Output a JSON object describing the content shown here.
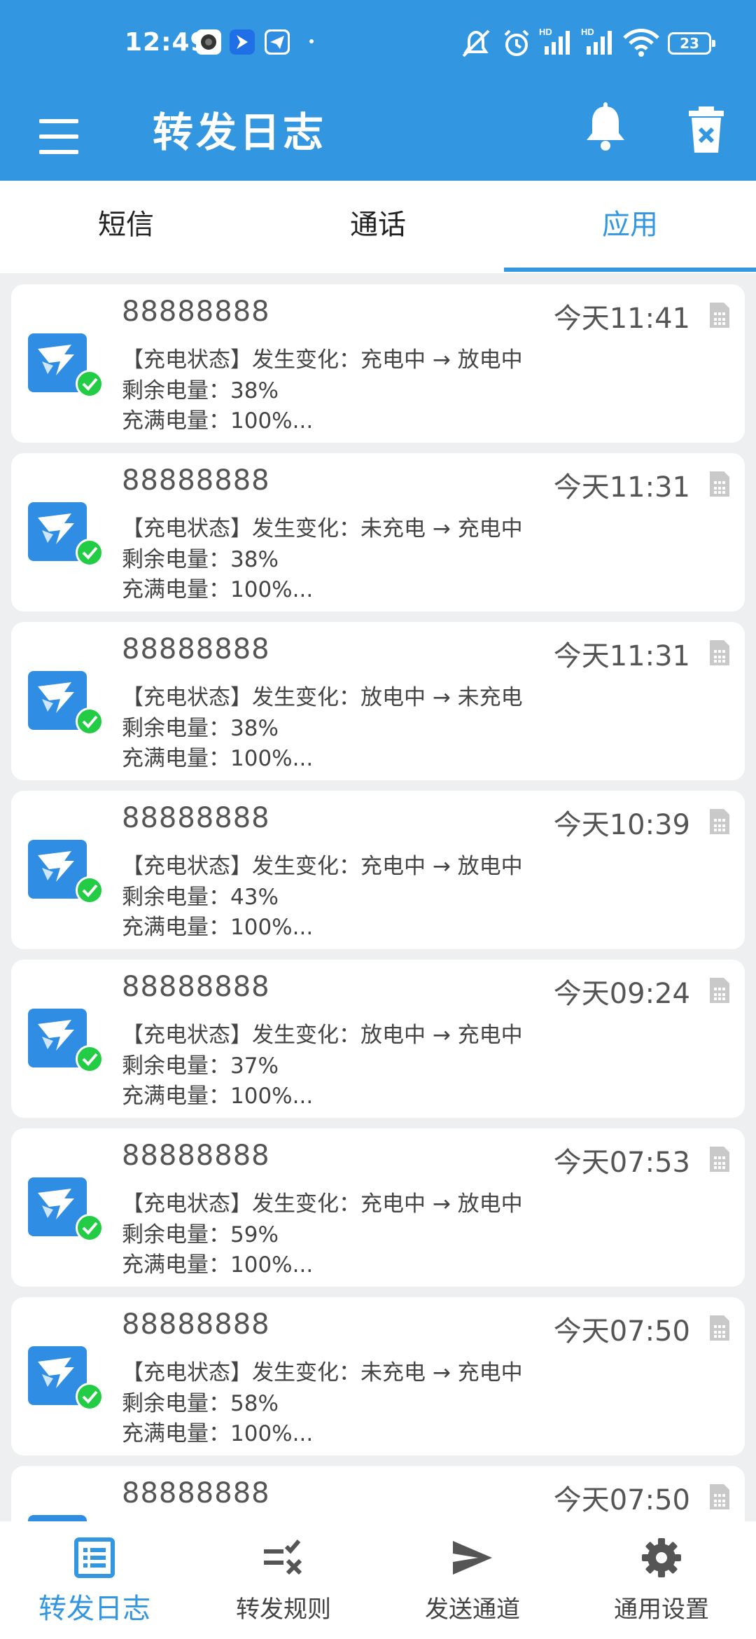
{
  "status_bar": {
    "time": "12:49",
    "battery": "23"
  },
  "toolbar": {
    "title": "转发日志"
  },
  "tabs": [
    {
      "label": "短信"
    },
    {
      "label": "通话"
    },
    {
      "label": "应用"
    }
  ],
  "logs": [
    {
      "sender": "88888888",
      "time": "今天11:41",
      "line1": "【充电状态】发生变化：充电中 → 放电中",
      "line2": "剩余电量：38%",
      "line3": "充满电量：100%..."
    },
    {
      "sender": "88888888",
      "time": "今天11:31",
      "line1": "【充电状态】发生变化：未充电 → 充电中",
      "line2": "剩余电量：38%",
      "line3": "充满电量：100%..."
    },
    {
      "sender": "88888888",
      "time": "今天11:31",
      "line1": "【充电状态】发生变化：放电中 → 未充电",
      "line2": "剩余电量：38%",
      "line3": "充满电量：100%..."
    },
    {
      "sender": "88888888",
      "time": "今天10:39",
      "line1": "【充电状态】发生变化：充电中 → 放电中",
      "line2": "剩余电量：43%",
      "line3": "充满电量：100%..."
    },
    {
      "sender": "88888888",
      "time": "今天09:24",
      "line1": "【充电状态】发生变化：放电中 → 充电中",
      "line2": "剩余电量：37%",
      "line3": "充满电量：100%..."
    },
    {
      "sender": "88888888",
      "time": "今天07:53",
      "line1": "【充电状态】发生变化：充电中 → 放电中",
      "line2": "剩余电量：59%",
      "line3": "充满电量：100%..."
    },
    {
      "sender": "88888888",
      "time": "今天07:50",
      "line1": "【充电状态】发生变化：未充电 → 充电中",
      "line2": "剩余电量：58%",
      "line3": "充满电量：100%..."
    },
    {
      "sender": "88888888",
      "time": "今天07:50",
      "line1": "",
      "line2": "",
      "line3": ""
    }
  ],
  "bottom_nav": [
    {
      "label": "转发日志"
    },
    {
      "label": "转发规则"
    },
    {
      "label": "发送通道"
    },
    {
      "label": "通用设置"
    }
  ],
  "colors": {
    "primary": "#3296e0",
    "success": "#22cc44",
    "background": "#eeeff1"
  }
}
